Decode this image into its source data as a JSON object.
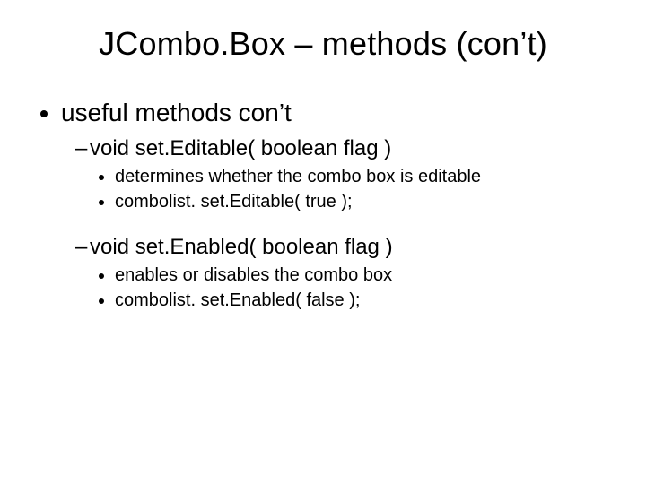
{
  "title": "JCombo.Box – methods (con’t)",
  "bullet1": "useful methods con’t",
  "method1": {
    "signature": "void set.Editable( boolean flag )",
    "desc1": "determines whether the combo box is editable",
    "desc2": "combolist. set.Editable( true );"
  },
  "method2": {
    "signature": "void set.Enabled( boolean flag )",
    "desc1": "enables or disables the combo box",
    "desc2": "combolist. set.Enabled( false );"
  }
}
